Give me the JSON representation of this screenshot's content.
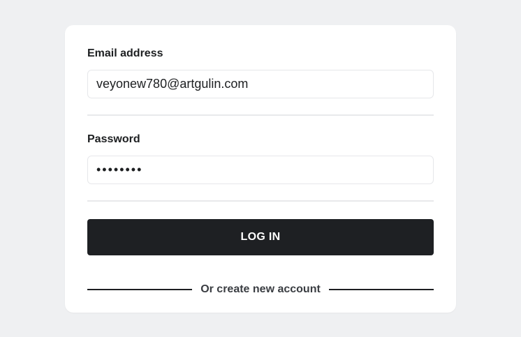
{
  "form": {
    "email_label": "Email address",
    "email_value": "veyonew780@artgulin.com",
    "password_label": "Password",
    "password_value": "••••••••",
    "login_label": "LOG IN",
    "create_account_text": "Or create new account"
  },
  "colors": {
    "background": "#eff0f2",
    "card": "#ffffff",
    "button": "#1e2023",
    "button_text": "#ffffff",
    "text": "#1d1f21"
  }
}
